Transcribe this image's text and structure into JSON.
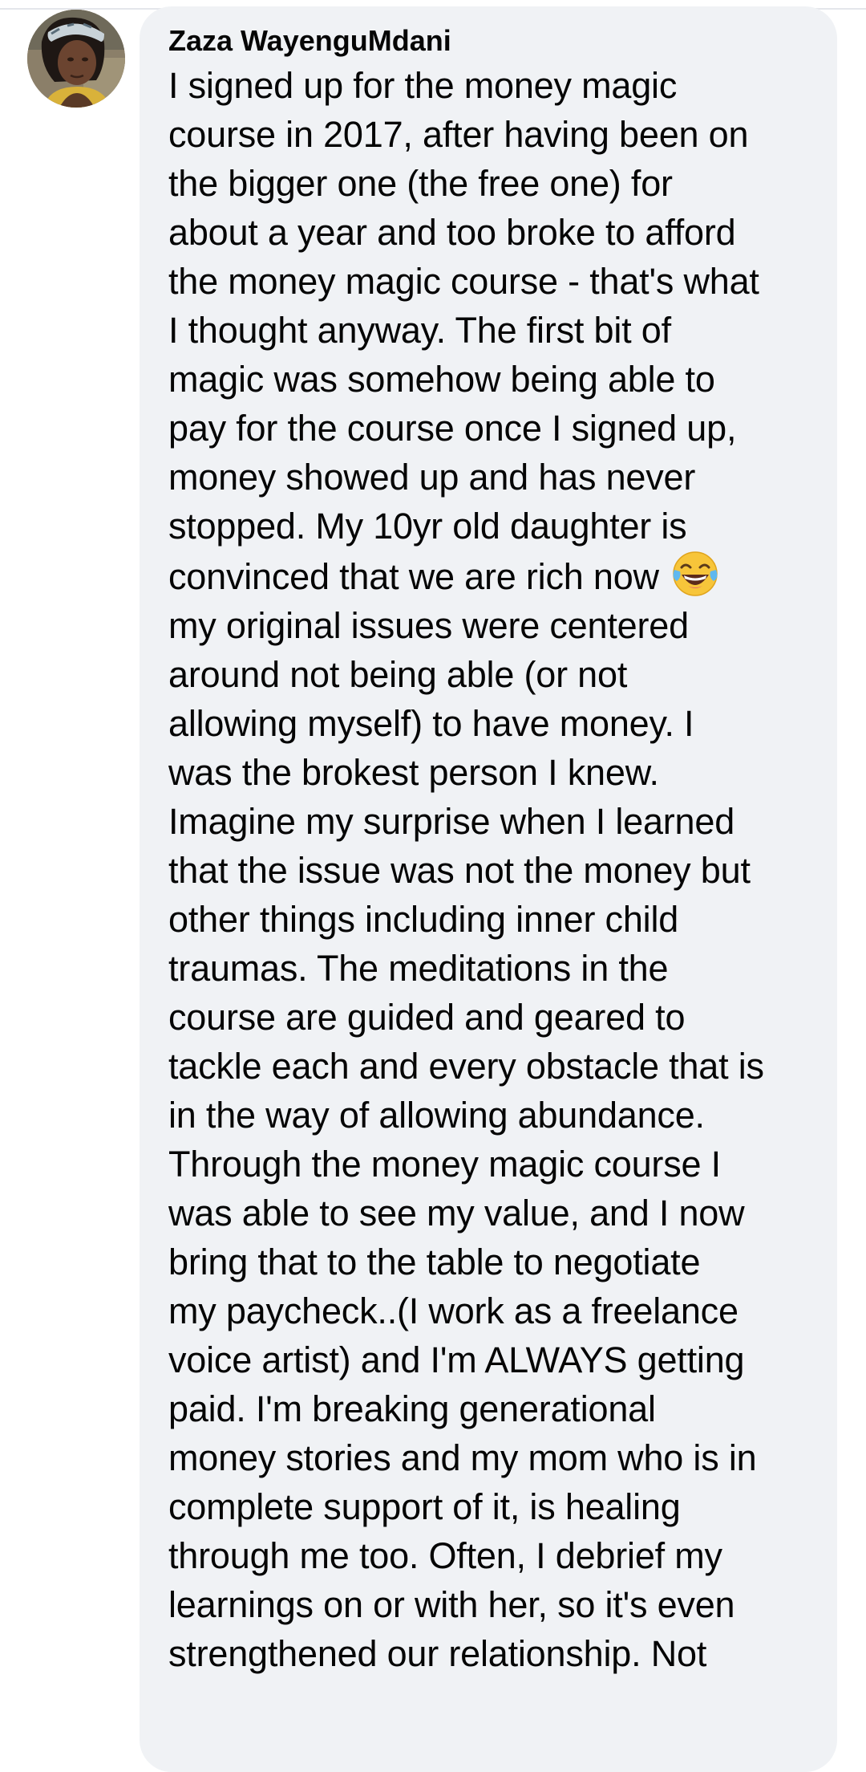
{
  "comment": {
    "author_name": "Zaza WayenguMdani",
    "avatar_icon": "user-avatar-photo",
    "text_before_emoji": "I signed up for the money magic\ncourse in 2017, after having been on\nthe bigger one (the free one) for\nabout a year and too broke to afford\nthe money magic course - that's what\nI thought anyway. The first bit of\nmagic was somehow being able to\npay for the course once I signed up,\nmoney showed up and has never\nstopped. My 10yr old daughter is\nconvinced that we are rich now ",
    "emoji": "face-with-tears-of-joy-emoji",
    "text_after_emoji": "\nmy original issues were centered\naround not being able (or not\nallowing myself) to have money. I\nwas the brokest person I knew.\nImagine my surprise when I learned\nthat the issue was not the money but\nother things including inner child\ntraumas. The meditations in the\ncourse are guided and geared to\ntackle each and every obstacle that is\nin the way of allowing abundance.\nThrough the money magic course I\nwas able to see my value, and I now\nbring that to the table to negotiate\nmy paycheck..(I work as a freelance\nvoice artist) and I'm ALWAYS getting\npaid. I'm breaking generational\nmoney stories and my mom who is in\ncomplete support of it, is healing\nthrough me too. Often, I debrief my\nlearnings on or with her, so it's even\nstrengthened our relationship. Not"
  },
  "colors": {
    "bubble_background": "#f0f2f5",
    "text": "#050505",
    "divider": "#e4e6eb"
  }
}
